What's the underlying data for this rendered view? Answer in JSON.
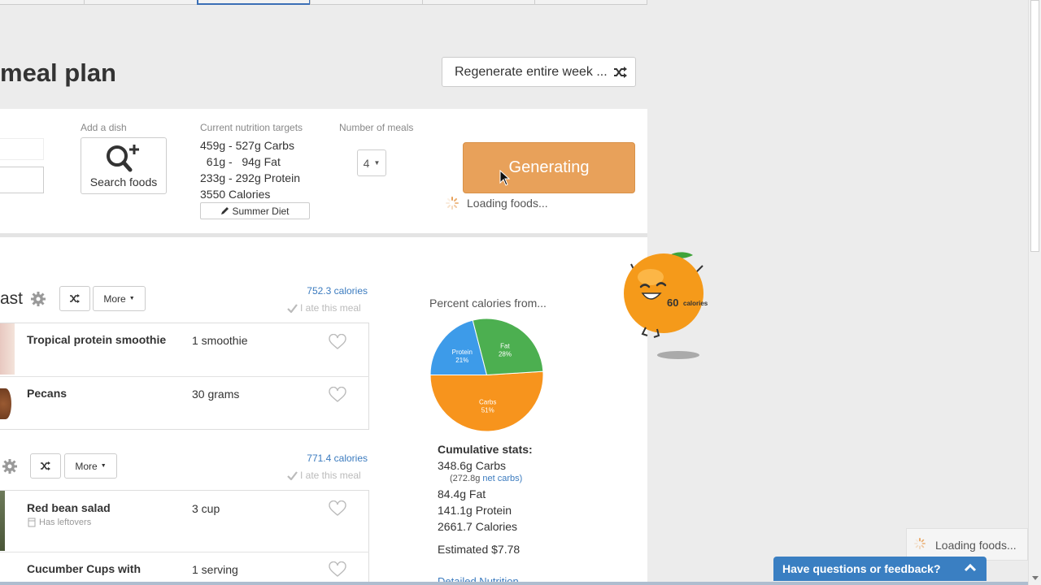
{
  "header": {
    "title": "meal plan",
    "regenerate_label": "Regenerate entire week ..."
  },
  "controls": {
    "add_dish_label": "Add a dish",
    "search_foods_label": "Search foods",
    "targets_label": "Current nutrition targets",
    "targets": [
      "459g - 527g Carbs",
      "  61g -   94g Fat",
      "233g - 292g Protein",
      "3550 Calories"
    ],
    "diet_label": "Summer Diet",
    "meals_label": "Number of meals",
    "meals_value": "4",
    "generate_label": "Generating",
    "loading_text": "Loading foods..."
  },
  "meals": [
    {
      "title": "ast",
      "more_label": "More",
      "calories": "752.3 calories",
      "ate_label": "I ate this meal",
      "foods": [
        {
          "name": "Tropical protein smoothie",
          "qty": "1 smoothie"
        },
        {
          "name": "Pecans",
          "qty": "30 grams"
        }
      ]
    },
    {
      "title": "",
      "more_label": "More",
      "calories": "771.4 calories",
      "ate_label": "I ate this meal",
      "foods": [
        {
          "name": "Red bean salad",
          "qty": "3 cup",
          "note": "Has leftovers"
        },
        {
          "name": "Cucumber Cups with",
          "qty": "1 serving"
        }
      ]
    }
  ],
  "summary": {
    "percent_label": "Percent calories from...",
    "cumulative_label": "Cumulative stats:",
    "carbs": "348.6g Carbs",
    "net_carbs_value": "(272.8g",
    "net_carbs_link": "net carbs)",
    "fat": "84.4g Fat",
    "protein": "141.1g Protein",
    "calories": "2661.7 Calories",
    "estimated": "Estimated $7.78",
    "detailed_link": "Detailed Nutrition"
  },
  "chart_data": {
    "type": "pie",
    "labels": [
      "Carbs",
      "Protein",
      "Fat"
    ],
    "values": [
      51,
      21,
      28
    ],
    "label_texts": [
      "51%",
      "21%",
      "28%"
    ],
    "colors": [
      "#f7941d",
      "#3d9be9",
      "#4caf50"
    ]
  },
  "mascot": {
    "calorie_text": "60",
    "calorie_unit": "calories"
  },
  "toast": {
    "loading_text": "Loading foods..."
  },
  "feedback": {
    "label": "Have questions or feedback?"
  },
  "icons": {
    "search": "search-plus-icon",
    "shuffle": "shuffle-icon",
    "gear": "gear-icon",
    "heart": "heart-icon",
    "pencil": "pencil-icon",
    "check": "check-icon",
    "spinner": "spinner-icon",
    "chevron": "chevron-up-icon"
  }
}
